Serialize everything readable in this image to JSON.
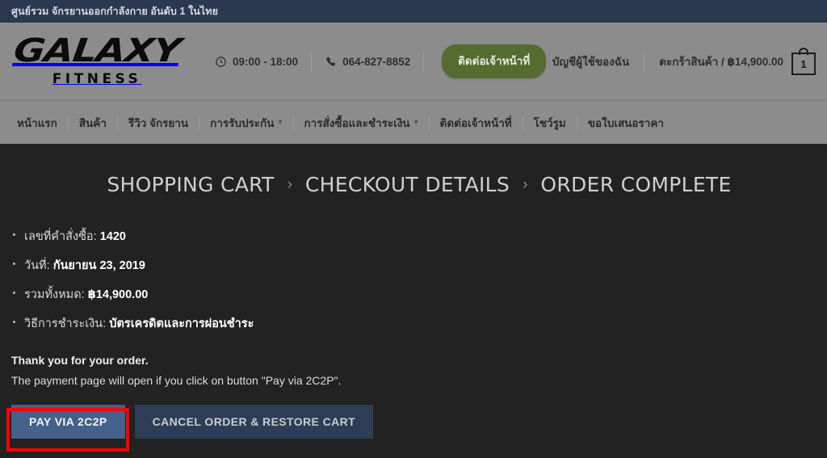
{
  "topbar": {
    "text": "ศูนย์รวม จักรยานออกกำลังกาย อันดับ 1 ในไทย"
  },
  "header": {
    "logo_main": "GALAXY",
    "logo_sub": "FITNESS",
    "hours": "09:00 - 18:00",
    "phone": "064-827-8852",
    "contact_button": "ติดต่อเจ้าหน้าที่",
    "account_link": "บัญชีผู้ใช้ของฉัน",
    "cart_label": "ตะกร้าสินค้า / ฿14,900.00",
    "cart_count": "1"
  },
  "nav": {
    "items": [
      {
        "label": "หน้าแรก",
        "has_chevron": false
      },
      {
        "label": "สินค้า",
        "has_chevron": false
      },
      {
        "label": "รีวิว จักรยาน",
        "has_chevron": false
      },
      {
        "label": "การรับประกัน",
        "has_chevron": true
      },
      {
        "label": "การสั่งซื้อและชำระเงิน",
        "has_chevron": true
      },
      {
        "label": "ติดต่อเจ้าหน้าที่",
        "has_chevron": false
      },
      {
        "label": "โชว์รูม",
        "has_chevron": false
      },
      {
        "label": "ขอใบเสนอราคา",
        "has_chevron": false
      }
    ]
  },
  "steps": {
    "cart": "SHOPPING CART",
    "separator": "›",
    "details": "CHECKOUT DETAILS",
    "complete": "ORDER COMPLETE"
  },
  "order": {
    "number_label": "เลขที่คำสั่งซื้อ:",
    "number_value": "1420",
    "date_label": "วันที่:",
    "date_value": "กันยายน 23, 2019",
    "total_label": "รวมทั้งหมด:",
    "total_value": "฿14,900.00",
    "payment_label": "วิธีการชำระเงิน:",
    "payment_value": "บัตรเครดิตและการผ่อนชำระ"
  },
  "message": {
    "thanks": "Thank you for your order.",
    "subtext": "The payment page will open if you click on button \"Pay via 2C2P\"."
  },
  "buttons": {
    "pay": "PAY VIA 2C2P",
    "cancel": "CANCEL ORDER & RESTORE CART"
  },
  "colors": {
    "topbar": "#2b3950",
    "header": "#8c8c8c",
    "body": "#222222",
    "contact_green": "#556b2f",
    "pay_blue": "#43618a",
    "cancel_blue": "#2c3d55",
    "highlight_red": "#ff0000"
  }
}
